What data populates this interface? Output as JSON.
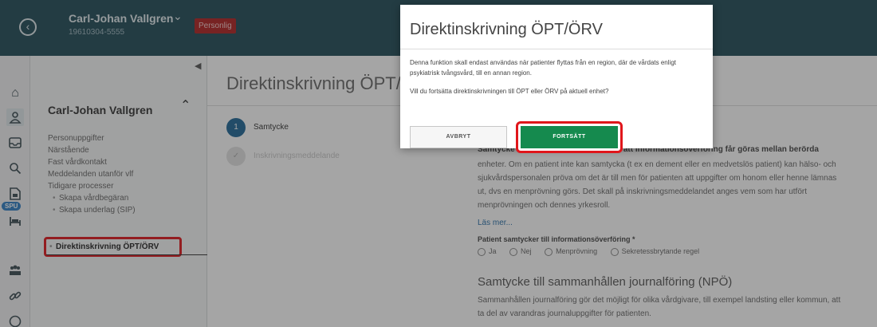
{
  "patient": {
    "name": "Carl-Johan Vallgren",
    "id": "19610304-5555",
    "protected_badge": "Personlig"
  },
  "iconbar": {
    "icons": [
      "home-icon",
      "patient-icon",
      "inbox-icon",
      "search-icon",
      "document-icon",
      "hospital-bed-icon",
      "organization-icon",
      "link-icon"
    ],
    "spu_badge": "SPU"
  },
  "sidebar": {
    "title": "Carl-Johan Vallgren",
    "links": [
      "Personuppgifter",
      "Närstående",
      "Fast vårdkontakt",
      "Meddelanden utanför vlf",
      "Tidigare processer"
    ],
    "sub_links": [
      "Skapa vårdbegäran",
      "Skapa underlag (SIP)"
    ],
    "active_item": "Direktinskrivning ÖPT/ÖRV"
  },
  "content": {
    "page_title": "Direktinskrivning ÖPT/ÖRV",
    "steps": [
      {
        "number": "1",
        "label": "Samtycke"
      },
      {
        "number": "✓",
        "label": "Inskrivningsmeddelande"
      }
    ],
    "section_heading": "Samtycke inhämtas från patienten om att informationsöverföring får göras mellan berörda",
    "section_text": "enheter. Om en patient inte kan samtycka (t ex en dement eller en medvetslös patient) kan hälso- och sjukvårdspersonalen pröva om det är till men för patienten att uppgifter om honom eller henne lämnas ut, dvs en menprövning görs. Det skall på inskrivningsmeddelandet anges vem som har utfört menprövningen och dennes yrkesroll.",
    "read_more": "Läs mer...",
    "question": "Patient samtycker till informationsöverföring *",
    "radio_options": [
      "Ja",
      "Nej",
      "Menprövning",
      "Sekretessbrytande regel"
    ],
    "npo_heading": "Samtycke till sammanhållen journalföring (NPÖ)",
    "npo_text": "Sammanhållen journalföring gör det möjligt för olika vårdgivare, till exempel landsting eller kommun, att ta del av varandras journaluppgifter för patienten."
  },
  "dialog": {
    "title": "Direktinskrivning ÖPT/ÖRV",
    "body_1": "Denna funktion skall endast användas när patienter flyttas från en region, där de vårdats enligt psykiatrisk tvångsvård, till en annan region.",
    "body_2": "Vill du fortsätta direktinskrivningen till ÖPT eller ÖRV på aktuell enhet?",
    "cancel_label": "AVBRYT",
    "continue_label": "FORTSÄTT"
  },
  "colors": {
    "topbar": "#1f4a57",
    "primary_green": "#158a4e",
    "highlight_red": "#e0161b",
    "step_active": "#1e6797"
  }
}
